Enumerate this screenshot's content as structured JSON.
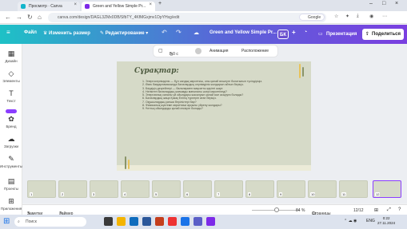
{
  "browser": {
    "tabs": [
      {
        "label": "Просмотр · Canva",
        "color": "#13b5cb"
      },
      {
        "label": "Green and Yellow Simple Pr...",
        "color": "#7d2ae8"
      }
    ],
    "url": "canva.com/design/DAGL3ZMx0DB/SfbTY_4KfMGxjmv1DpYHsg/edit",
    "google_chip": "Google"
  },
  "header": {
    "file": "Файл",
    "resize": "Изменить размер",
    "editing": "Редактирование",
    "design_title": "Green and Yellow Simple Pr...",
    "avatar": "БК",
    "present": "Презентация",
    "share": "Поделиться"
  },
  "sidebar": {
    "items": [
      {
        "label": "Дизайн",
        "icon": "design-icon"
      },
      {
        "label": "Элементы",
        "icon": "elements-icon"
      },
      {
        "label": "Текст",
        "icon": "text-icon"
      },
      {
        "label": "Бренд",
        "icon": "brand-icon"
      },
      {
        "label": "Загрузки",
        "icon": "uploads-icon"
      },
      {
        "label": "Инструменты",
        "icon": "tools-icon"
      },
      {
        "label": "Проекты",
        "icon": "projects-icon"
      },
      {
        "label": "Приложения",
        "icon": "apps-icon"
      }
    ]
  },
  "toolbar": {
    "duration": "5,0 с",
    "animation": "Анимация",
    "position": "Расположение"
  },
  "slide": {
    "title": "Сұрақтар:",
    "questions": [
      "1. Энергосерпімділік — бұл сандық көрсеткіш, оны қалай өлшеуге болатынын түсіндіріңіз.",
      "2. Өзек бағдарламасында балалардың серпімділік жолдарын айтып беріңіз.",
      "3. Бердіңіз деңгейлері — балалармен мақсатты қауіпті шарт.",
      "4. Неліктен балалардың жағымды мағыналы әсері көрсетіледі?",
      "5. Энергиялық сапалы үй ойындары жасалуын қалай іске асыруға болады?",
      "6. Балалардың жаңа Қазақ Елінің түрлерін атап беріңіз.",
      "7. Оқушылардың қанша берілістері бар?",
      "8. Физикалық жүктеме көрсеткіші арқылы үйрену жолдары?",
      "9. Ұлттық ойындарды қалай өткізуге болады?"
    ]
  },
  "thumbnails": [
    "1",
    "2",
    "3",
    "4",
    "5",
    "6",
    "7",
    "8",
    "9",
    "10",
    "11",
    "12"
  ],
  "bottombar": {
    "notes": "Заметки",
    "timer": "Таймер",
    "zoom": "84 %",
    "pages": "Страницы",
    "page_count": "12/12"
  },
  "taskbar": {
    "search": "Поиск",
    "tray_lang": "ENG",
    "time": "0:22",
    "date": "27.11.2024"
  },
  "colors": {
    "accent": "#8b3dff",
    "slide_bg": "#d6dac8",
    "title": "#4d5a3f"
  }
}
